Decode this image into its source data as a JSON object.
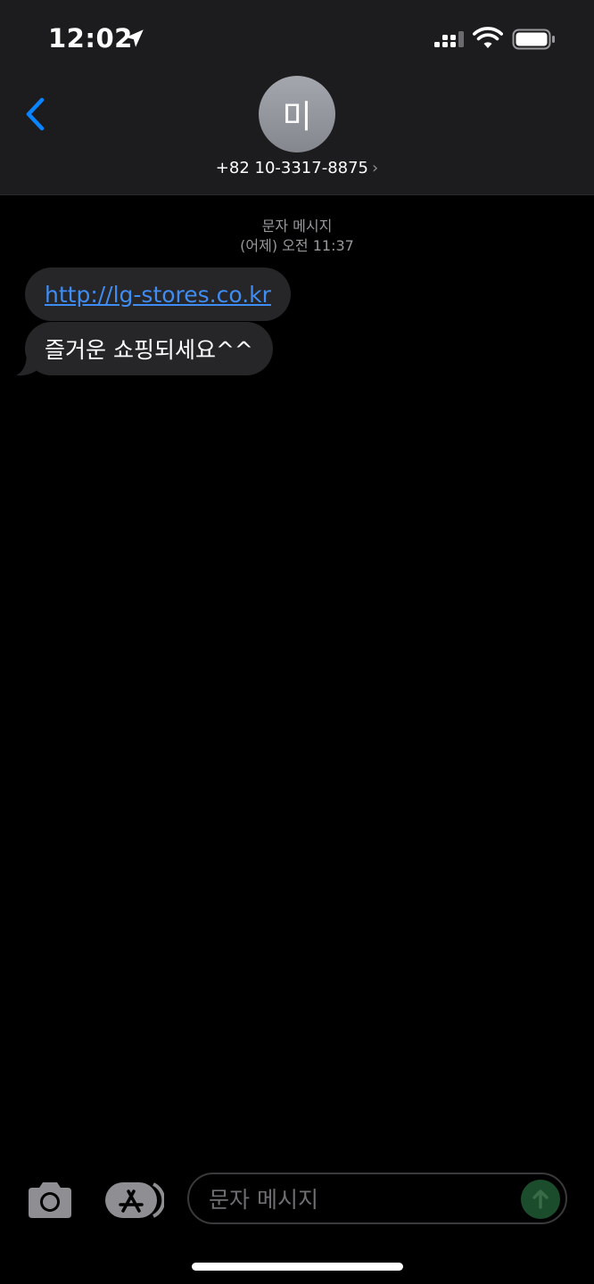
{
  "status_bar": {
    "time": "12:02",
    "icons": [
      "location-arrow-icon",
      "cellular-signal-icon",
      "wifi-icon",
      "battery-icon"
    ]
  },
  "header": {
    "back_icon": "chevron-left-icon",
    "avatar_initial": "미",
    "contact_number": "+82 10-3317-8875",
    "chevron": "›"
  },
  "conversation": {
    "service_label": "문자 메시지",
    "timestamp": "(어제) 오전 11:37",
    "messages": [
      {
        "text": "http://lg-stores.co.kr",
        "is_link": true
      },
      {
        "text": "즐거운 쇼핑되세요^^",
        "is_link": false
      }
    ]
  },
  "input_bar": {
    "camera_icon": "camera-icon",
    "appstore_icon": "app-store-icon",
    "placeholder": "문자 메시지",
    "send_icon": "arrow-up-icon"
  },
  "colors": {
    "header_bg": "#1c1c1e",
    "bubble_bg": "#262629",
    "link": "#3f8cf2",
    "accent_blue": "#0a84ff",
    "send_button": "#1b4d2c"
  }
}
